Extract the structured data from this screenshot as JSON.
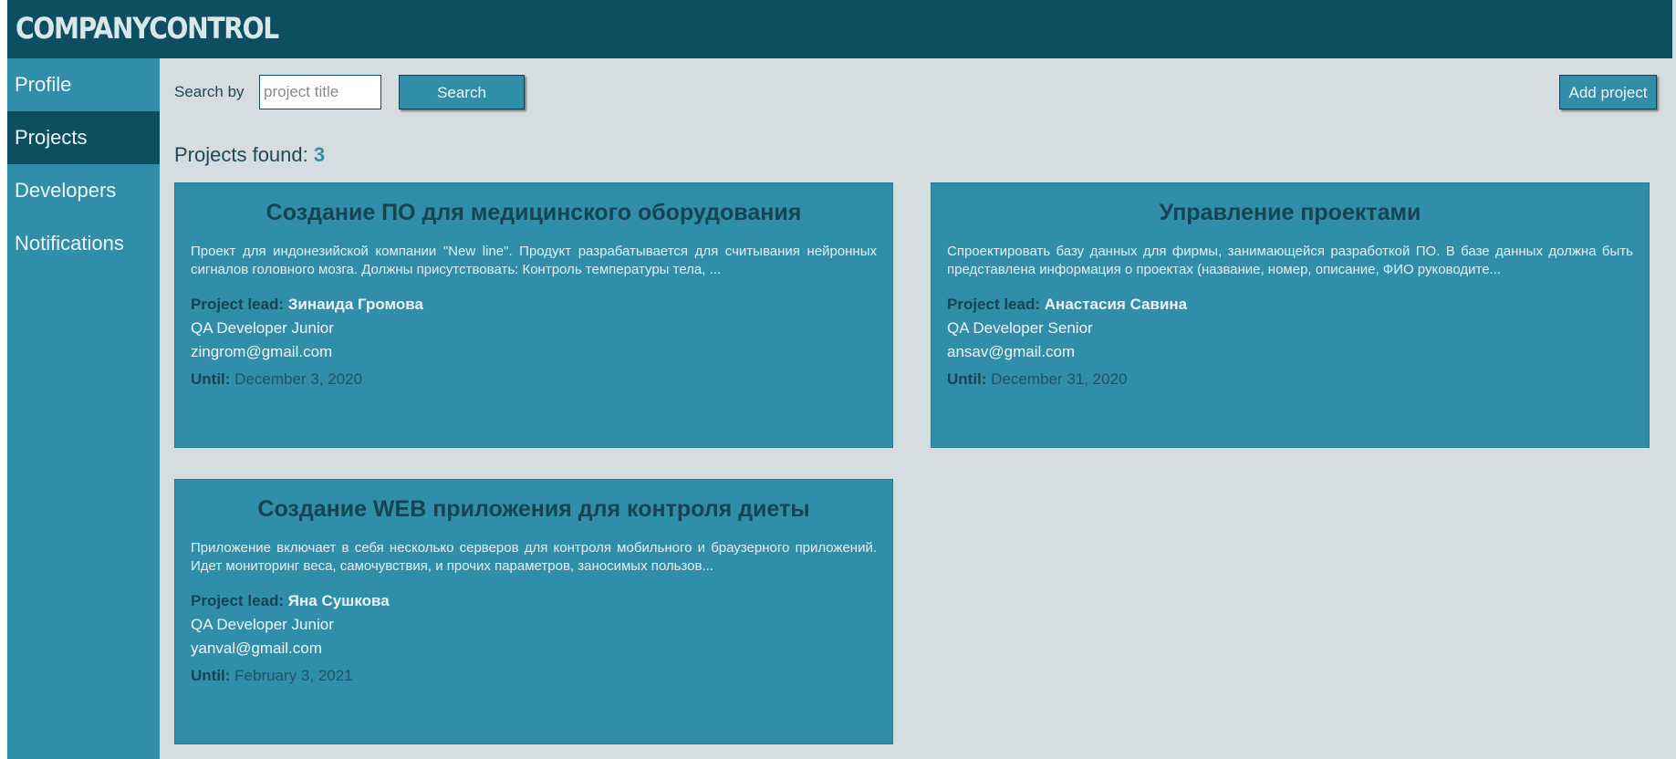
{
  "app": {
    "logo": "COMPANYCONTROL"
  },
  "sidebar": {
    "items": [
      {
        "label": "Profile",
        "active": false
      },
      {
        "label": "Projects",
        "active": true
      },
      {
        "label": "Developers",
        "active": false
      },
      {
        "label": "Notifications",
        "active": false
      }
    ]
  },
  "search": {
    "label": "Search by",
    "placeholder": "project title",
    "value": "",
    "button_label": "Search"
  },
  "toolbar": {
    "add_project_label": "Add project"
  },
  "results": {
    "label": "Projects found:",
    "count": "3"
  },
  "labels": {
    "project_lead": "Project lead:",
    "until": "Until:"
  },
  "projects": [
    {
      "title": "Создание ПО для медицинского оборудования",
      "description": "Проект для индонезийской компании \"New line\". Продукт разрабатывается для считывания нейронных сигналов головного мозга. Должны присутствовать: Контроль температуры тела, ...",
      "lead_name": "Зинаида Громова",
      "lead_role": "QA Developer Junior",
      "lead_email": "zingrom@gmail.com",
      "until": "December 3, 2020"
    },
    {
      "title": "Управление проектами",
      "description": "Спроектировать базу данных для фирмы, занимающейся разработкой ПО. В базе данных должна быть представлена информация о проектах (название, номер, описание, ФИО руководите...",
      "lead_name": "Анастасия Савина",
      "lead_role": "QA Developer Senior",
      "lead_email": "ansav@gmail.com",
      "until": "December 31, 2020"
    },
    {
      "title": "Создание WEB приложения для контроля диеты",
      "description": "Приложение включает в себя несколько серверов для контроля мобильного и браузерного приложений. Идет мониторинг веса, самочувствия, и прочих параметров, заносимых пользов...",
      "lead_name": "Яна Сушкова",
      "lead_role": "QA Developer Junior",
      "lead_email": "yanval@gmail.com",
      "until": "February 3, 2021"
    }
  ],
  "colors": {
    "header": "#0d4f60",
    "sidebar": "#318ea8",
    "background": "#d5dde0",
    "card": "#318ea8",
    "title_text": "#154452"
  }
}
